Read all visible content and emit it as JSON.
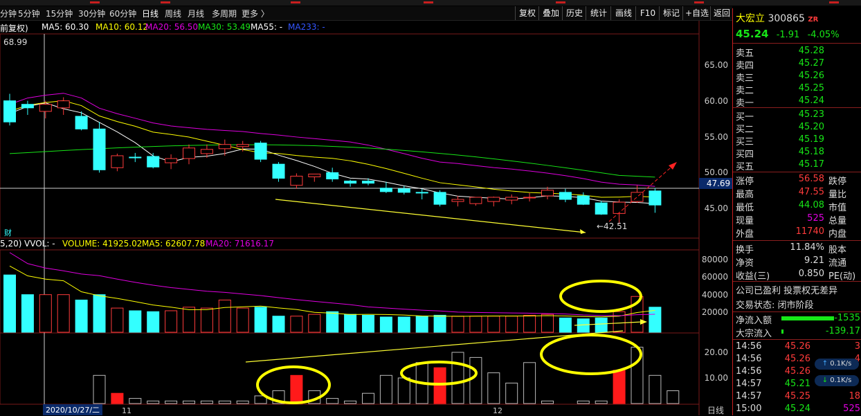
{
  "toolbar": {
    "periods": [
      "分钟",
      "5分钟",
      "15分钟",
      "30分钟",
      "60分钟",
      "日线",
      "周线",
      "月线",
      "多周期",
      "更多 〉"
    ],
    "buttons": [
      "复权",
      "叠加",
      "历史",
      "统计",
      "画线",
      "F10",
      "标记",
      "+自选",
      "返回"
    ]
  },
  "price_indicators": {
    "prefix": "前复权)",
    "ma5": "MA5: 60.30",
    "ma10": "MA10: 60.12",
    "ma20": "MA20: 56.50",
    "ma30": "MA30: 53.49",
    "ma55": "MA55: -",
    "ma233": "MA233: -"
  },
  "volume_indicators": {
    "prefix": "5,20)",
    "vvol": "VVOL: -",
    "volume": "VOLUME: 41925.02",
    "ma5": "MA5: 62607.78",
    "ma20": "MA20: 71616.17"
  },
  "chart_labels": {
    "high_label": "68.99",
    "low_label": "←42.51",
    "fin_icon": "财",
    "cursor_price": "47.69",
    "date_cursor": "2020/10/27/二",
    "month_11": "11",
    "month_12": "12",
    "period_tab": "日线"
  },
  "price_axis": [
    "65.00",
    "60.00",
    "55.00",
    "50.00",
    "45.00"
  ],
  "vol_axis": [
    "80000",
    "60000",
    "40000",
    "20000"
  ],
  "sub_axis": [
    "20.00",
    "10.00"
  ],
  "stock": {
    "name": "大宏立",
    "code": "300865",
    "tag": "ZR",
    "price": "45.24",
    "change": "-1.91",
    "change_pct": "-4.05%"
  },
  "asks": [
    {
      "label": "卖五",
      "price": "45.28"
    },
    {
      "label": "卖四",
      "price": "45.27"
    },
    {
      "label": "卖三",
      "price": "45.26"
    },
    {
      "label": "卖二",
      "price": "45.25"
    },
    {
      "label": "卖一",
      "price": "45.24"
    }
  ],
  "bids": [
    {
      "label": "买一",
      "price": "45.23"
    },
    {
      "label": "买二",
      "price": "45.20"
    },
    {
      "label": "买三",
      "price": "45.19"
    },
    {
      "label": "买四",
      "price": "45.18"
    },
    {
      "label": "买五",
      "price": "45.17"
    }
  ],
  "stats": [
    {
      "l1": "涨停",
      "v1": "56.58",
      "c1": "#ff3b3b",
      "l2": "跌停"
    },
    {
      "l1": "最高",
      "v1": "47.55",
      "c1": "#ff3b3b",
      "l2": "量比"
    },
    {
      "l1": "最低",
      "v1": "44.08",
      "c1": "#17e617",
      "l2": "市值"
    },
    {
      "l1": "现量",
      "v1": "525",
      "c1": "#e000e0",
      "l2": "总量"
    },
    {
      "l1": "外盘",
      "v1": "11740",
      "c1": "#ff3b3b",
      "l2": "内盘"
    }
  ],
  "stats2": [
    {
      "l1": "换手",
      "v1": "11.84%",
      "l2": "股本"
    },
    {
      "l1": "净资",
      "v1": "9.21",
      "l2": "流通"
    },
    {
      "l1": "收益(三)",
      "v1": "0.850",
      "l2": "PE(动)"
    }
  ],
  "company": {
    "line1": "公司已盈利 投票权无差异",
    "line2": "交易状态: 闭市阶段"
  },
  "flows": [
    {
      "label": "净流入额",
      "value": "-1535"
    },
    {
      "label": "大宗流入",
      "value": "-139.17"
    }
  ],
  "ticks": [
    {
      "time": "14:56",
      "price": "45.26",
      "vol": "3"
    },
    {
      "time": "14:56",
      "price": "45.26",
      "vol": "4"
    },
    {
      "time": "14:56",
      "price": "45.26",
      "vol": ""
    },
    {
      "time": "14:57",
      "price": "45.21",
      "vol": ""
    },
    {
      "time": "14:57",
      "price": "45.25",
      "vol": "18"
    },
    {
      "time": "15:00",
      "price": "45.24",
      "vol": "525"
    }
  ],
  "speed": [
    "0.1K/s",
    "0.1K/s"
  ],
  "chart_data": {
    "type": "candlestick",
    "ohlc": [
      [
        60.0,
        61.0,
        56.5,
        57.0
      ],
      [
        59.5,
        60.0,
        58.0,
        59.0
      ],
      [
        58.5,
        60.0,
        57.5,
        59.5
      ],
      [
        59.0,
        60.5,
        58.0,
        60.0
      ],
      [
        57.8,
        58.5,
        55.8,
        56.0
      ],
      [
        56.0,
        57.0,
        49.8,
        50.2
      ],
      [
        50.5,
        52.5,
        50.0,
        52.2
      ],
      [
        52.0,
        52.6,
        51.3,
        51.9
      ],
      [
        52.1,
        52.6,
        50.4,
        50.6
      ],
      [
        51.2,
        52.4,
        50.3,
        51.8
      ],
      [
        51.8,
        53.8,
        51.0,
        53.3
      ],
      [
        52.5,
        53.8,
        51.9,
        53.1
      ],
      [
        53.2,
        54.5,
        52.2,
        53.8
      ],
      [
        53.5,
        54.3,
        52.8,
        53.8
      ],
      [
        54.0,
        54.3,
        51.3,
        51.7
      ],
      [
        51.0,
        51.3,
        48.5,
        49.0
      ],
      [
        48.0,
        49.7,
        47.5,
        49.3
      ],
      [
        49.2,
        49.5,
        48.5,
        49.6
      ],
      [
        49.8,
        50.5,
        48.5,
        48.9
      ],
      [
        48.6,
        48.8,
        47.8,
        48.3
      ],
      [
        48.6,
        49.0,
        48.0,
        48.3
      ],
      [
        47.6,
        48.5,
        46.9,
        47.1
      ],
      [
        47.5,
        47.9,
        46.7,
        47.0
      ],
      [
        47.0,
        47.5,
        46.0,
        46.9
      ],
      [
        47.0,
        47.3,
        45.0,
        45.3
      ],
      [
        45.7,
        46.5,
        45.0,
        46.0
      ],
      [
        45.4,
        46.2,
        45.1,
        46.3
      ],
      [
        45.7,
        46.4,
        45.0,
        46.3
      ],
      [
        45.9,
        46.7,
        45.3,
        46.3
      ],
      [
        46.2,
        46.9,
        45.7,
        46.3
      ],
      [
        46.5,
        47.8,
        46.0,
        47.3
      ],
      [
        47.0,
        47.5,
        45.6,
        46.0
      ],
      [
        46.5,
        47.0,
        45.2,
        45.3
      ],
      [
        45.5,
        45.8,
        43.8,
        43.9
      ],
      [
        44.0,
        46.0,
        42.5,
        45.6
      ],
      [
        45.7,
        48.0,
        45.5,
        47.0
      ],
      [
        47.2,
        47.6,
        44.1,
        45.2
      ]
    ],
    "volume": [
      64000,
      42000,
      42000,
      42000,
      36000,
      42000,
      27000,
      24000,
      23000,
      24000,
      28000,
      27000,
      36000,
      27000,
      28000,
      18000,
      18000,
      20000,
      23000,
      20000,
      19000,
      17000,
      17000,
      18000,
      19000,
      18000,
      18000,
      18000,
      18000,
      19000,
      20000,
      16000,
      15000,
      16000,
      23000,
      40000,
      28000
    ],
    "sub_values": [
      0,
      0,
      0,
      0,
      0,
      11,
      4,
      2,
      1,
      1,
      1,
      1,
      1,
      1,
      3,
      5,
      11,
      5,
      2,
      1,
      4,
      11,
      10,
      16,
      14,
      20,
      18,
      12,
      8,
      16,
      1,
      0,
      1,
      1,
      13,
      22,
      11,
      5
    ],
    "price_ylim": [
      42,
      68.99
    ],
    "vol_ylim": [
      0,
      90000
    ],
    "ma_colors": {
      "ma5": "#ffffff",
      "ma10": "#ffff00",
      "ma20": "#e000e0",
      "ma30": "#17e617"
    }
  }
}
